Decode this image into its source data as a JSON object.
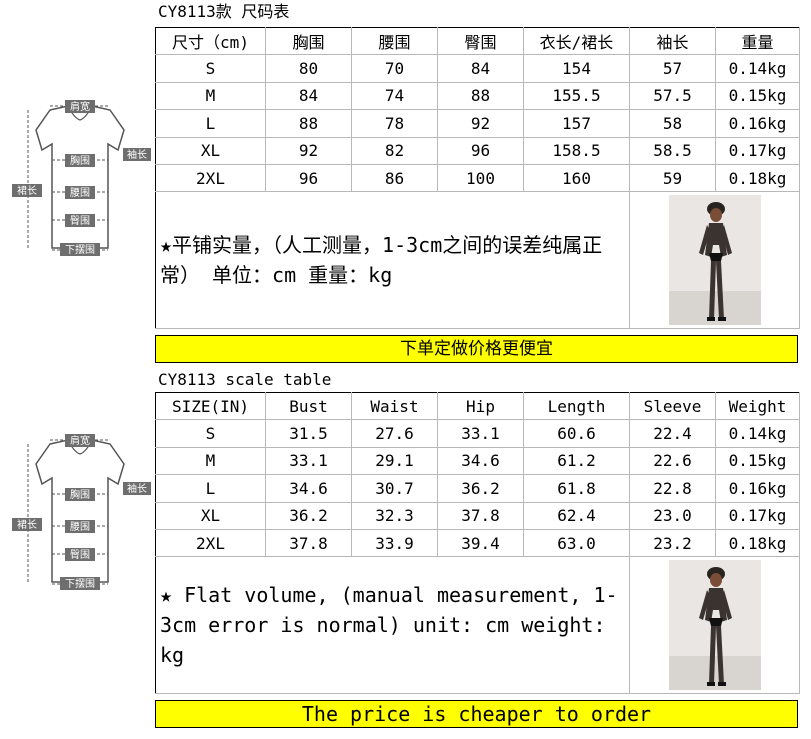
{
  "cn": {
    "caption": "CY8113款 尺码表",
    "headers": [
      "尺寸（cm)",
      "胸围",
      "腰围",
      "臀围",
      "衣长/裙长",
      "袖长",
      "重量"
    ],
    "rows": [
      [
        "S",
        "80",
        "70",
        "84",
        "154",
        "57",
        "0.14kg"
      ],
      [
        "M",
        "84",
        "74",
        "88",
        "155.5",
        "57.5",
        "0.15kg"
      ],
      [
        "L",
        "88",
        "78",
        "92",
        "157",
        "58",
        "0.16kg"
      ],
      [
        "XL",
        "92",
        "82",
        "96",
        "158.5",
        "58.5",
        "0.17kg"
      ],
      [
        "2XL",
        "96",
        "86",
        "100",
        "160",
        "59",
        "0.18kg"
      ]
    ],
    "note": "★平铺实量，（人工测量，1-3cm之间的误差纯属正常） 单位：cm  重量：kg",
    "banner": "下单定做价格更便宜",
    "figure_labels": {
      "shoulder": "肩宽",
      "sleeve": "袖长",
      "bust": "胸围",
      "length": "裙长",
      "waist": "腰围",
      "hip": "臀围",
      "hem": "下摆围"
    }
  },
  "en": {
    "caption": "CY8113 scale table",
    "headers": [
      "SIZE(IN)",
      "Bust",
      "Waist",
      "Hip",
      "Length",
      "Sleeve",
      "Weight"
    ],
    "rows": [
      [
        "S",
        "31.5",
        "27.6",
        "33.1",
        "60.6",
        "22.4",
        "0.14kg"
      ],
      [
        "M",
        "33.1",
        "29.1",
        "34.6",
        "61.2",
        "22.6",
        "0.15kg"
      ],
      [
        "L",
        "34.6",
        "30.7",
        "36.2",
        "61.8",
        "22.8",
        "0.16kg"
      ],
      [
        "XL",
        "36.2",
        "32.3",
        "37.8",
        "62.4",
        "23.0",
        "0.17kg"
      ],
      [
        "2XL",
        "37.8",
        "33.9",
        "39.4",
        "63.0",
        "23.2",
        "0.18kg"
      ]
    ],
    "note": "★ Flat volume, (manual measurement, 1-3cm error is normal) unit: cm weight: kg",
    "banner": "The price is cheaper to order",
    "figure_labels": {
      "shoulder": "肩宽",
      "sleeve": "袖长",
      "bust": "胸围",
      "length": "裙长",
      "waist": "腰围",
      "hip": "臀围",
      "hem": "下摆围"
    }
  },
  "colors": {
    "banner": "#ffff00",
    "grid_line": "#b8b8b8",
    "figure_line": "#555555",
    "label_bg": "#6e6e6e"
  },
  "icons": {
    "garment": "dress-diagram-icon",
    "model": "model-photo-icon"
  }
}
